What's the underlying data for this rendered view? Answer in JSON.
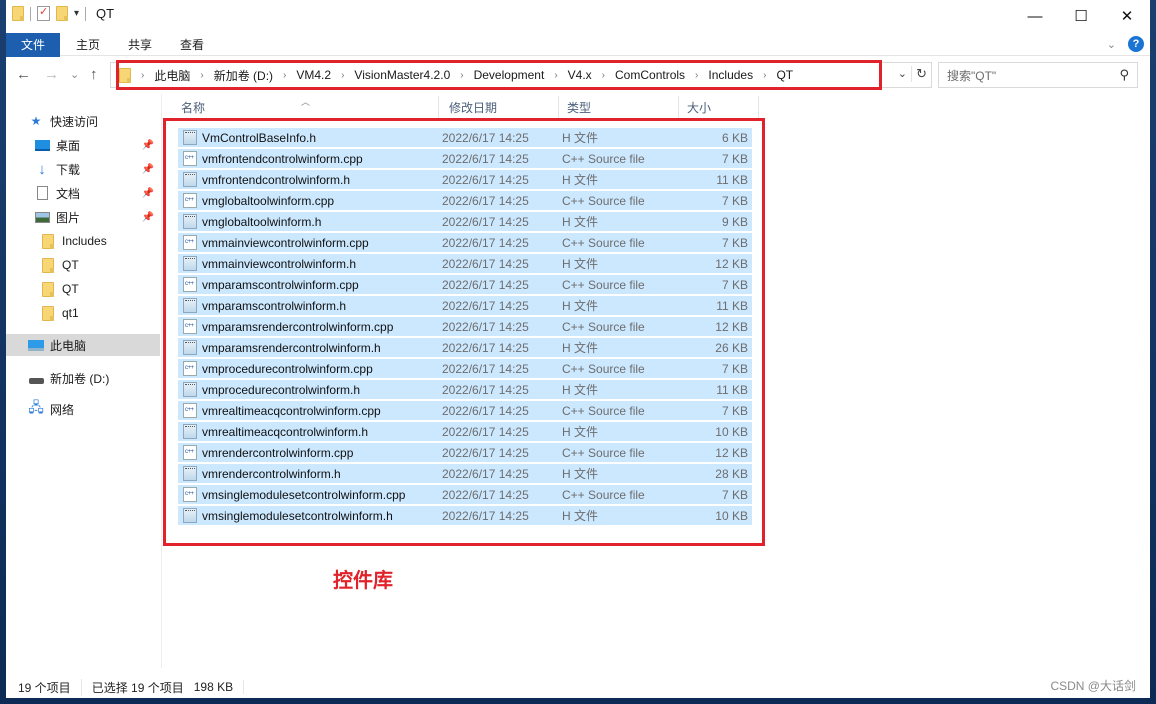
{
  "window": {
    "title": "QT",
    "controls": {
      "minimize": "—",
      "maximize": "☐",
      "close": "✕"
    }
  },
  "ribbon": {
    "tabs": [
      "文件",
      "主页",
      "共享",
      "查看"
    ]
  },
  "navigation": {
    "back": "←",
    "forward": "→",
    "recent": "⌄",
    "up": "↑",
    "breadcrumb": [
      "此电脑",
      "新加卷 (D:)",
      "VM4.2",
      "VisionMaster4.2.0",
      "Development",
      "V4.x",
      "ComControls",
      "Includes",
      "QT"
    ],
    "search_placeholder": "搜索\"QT\""
  },
  "sidebar": {
    "items": [
      {
        "label": "快速访问",
        "icon": "star-icon"
      },
      {
        "label": "桌面",
        "icon": "desktop-icon",
        "pinned": true
      },
      {
        "label": "下载",
        "icon": "download-icon",
        "pinned": true
      },
      {
        "label": "文档",
        "icon": "document-icon",
        "pinned": true
      },
      {
        "label": "图片",
        "icon": "pictures-icon",
        "pinned": true
      },
      {
        "label": "Includes",
        "icon": "folder-icon"
      },
      {
        "label": "QT",
        "icon": "folder-icon"
      },
      {
        "label": "QT",
        "icon": "folder-icon"
      },
      {
        "label": "qt1",
        "icon": "folder-icon"
      },
      {
        "label": "此电脑",
        "icon": "computer-icon",
        "selected": true
      },
      {
        "label": "新加卷 (D:)",
        "icon": "drive-icon"
      },
      {
        "label": "网络",
        "icon": "network-icon"
      }
    ]
  },
  "columns": {
    "name": "名称",
    "date": "修改日期",
    "type": "类型",
    "size": "大小"
  },
  "files": [
    {
      "name": "VmControlBaseInfo.h",
      "date": "2022/6/17 14:25",
      "type": "H 文件",
      "size": "6 KB",
      "kind": "h"
    },
    {
      "name": "vmfrontendcontrolwinform.cpp",
      "date": "2022/6/17 14:25",
      "type": "C++ Source file",
      "size": "7 KB",
      "kind": "cpp"
    },
    {
      "name": "vmfrontendcontrolwinform.h",
      "date": "2022/6/17 14:25",
      "type": "H 文件",
      "size": "11 KB",
      "kind": "h"
    },
    {
      "name": "vmglobaltoolwinform.cpp",
      "date": "2022/6/17 14:25",
      "type": "C++ Source file",
      "size": "7 KB",
      "kind": "cpp"
    },
    {
      "name": "vmglobaltoolwinform.h",
      "date": "2022/6/17 14:25",
      "type": "H 文件",
      "size": "9 KB",
      "kind": "h"
    },
    {
      "name": "vmmainviewcontrolwinform.cpp",
      "date": "2022/6/17 14:25",
      "type": "C++ Source file",
      "size": "7 KB",
      "kind": "cpp"
    },
    {
      "name": "vmmainviewcontrolwinform.h",
      "date": "2022/6/17 14:25",
      "type": "H 文件",
      "size": "12 KB",
      "kind": "h"
    },
    {
      "name": "vmparamscontrolwinform.cpp",
      "date": "2022/6/17 14:25",
      "type": "C++ Source file",
      "size": "7 KB",
      "kind": "cpp"
    },
    {
      "name": "vmparamscontrolwinform.h",
      "date": "2022/6/17 14:25",
      "type": "H 文件",
      "size": "11 KB",
      "kind": "h"
    },
    {
      "name": "vmparamsrendercontrolwinform.cpp",
      "date": "2022/6/17 14:25",
      "type": "C++ Source file",
      "size": "12 KB",
      "kind": "cpp"
    },
    {
      "name": "vmparamsrendercontrolwinform.h",
      "date": "2022/6/17 14:25",
      "type": "H 文件",
      "size": "26 KB",
      "kind": "h"
    },
    {
      "name": "vmprocedurecontrolwinform.cpp",
      "date": "2022/6/17 14:25",
      "type": "C++ Source file",
      "size": "7 KB",
      "kind": "cpp"
    },
    {
      "name": "vmprocedurecontrolwinform.h",
      "date": "2022/6/17 14:25",
      "type": "H 文件",
      "size": "11 KB",
      "kind": "h"
    },
    {
      "name": "vmrealtimeacqcontrolwinform.cpp",
      "date": "2022/6/17 14:25",
      "type": "C++ Source file",
      "size": "7 KB",
      "kind": "cpp"
    },
    {
      "name": "vmrealtimeacqcontrolwinform.h",
      "date": "2022/6/17 14:25",
      "type": "H 文件",
      "size": "10 KB",
      "kind": "h"
    },
    {
      "name": "vmrendercontrolwinform.cpp",
      "date": "2022/6/17 14:25",
      "type": "C++ Source file",
      "size": "12 KB",
      "kind": "cpp"
    },
    {
      "name": "vmrendercontrolwinform.h",
      "date": "2022/6/17 14:25",
      "type": "H 文件",
      "size": "28 KB",
      "kind": "h"
    },
    {
      "name": "vmsinglemodulesetcontrolwinform.cpp",
      "date": "2022/6/17 14:25",
      "type": "C++ Source file",
      "size": "7 KB",
      "kind": "cpp"
    },
    {
      "name": "vmsinglemodulesetcontrolwinform.h",
      "date": "2022/6/17 14:25",
      "type": "H 文件",
      "size": "10 KB",
      "kind": "h"
    }
  ],
  "annotation": "控件库",
  "status": {
    "count": "19 个项目",
    "selected": "已选择 19 个项目",
    "size": "198 KB"
  },
  "watermark": "CSDN @大话剑",
  "colors": {
    "accent": "#1d5fae",
    "selection": "#cce8ff",
    "highlight_box": "#e0222a"
  }
}
